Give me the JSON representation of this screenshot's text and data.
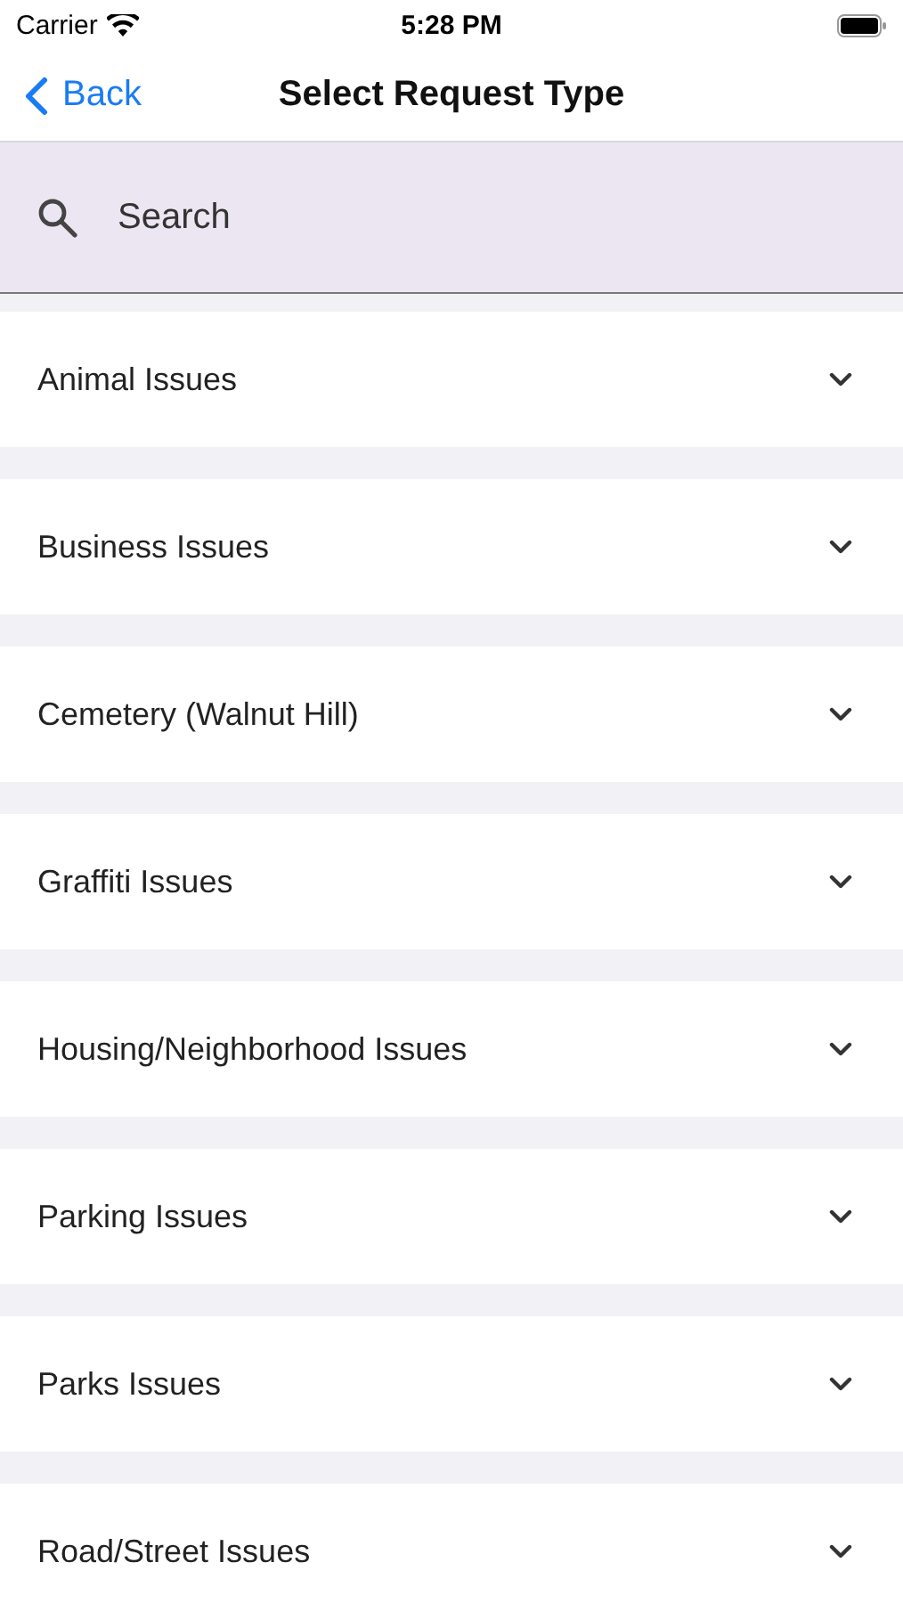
{
  "status_bar": {
    "carrier": "Carrier",
    "time": "5:28 PM"
  },
  "nav": {
    "back": "Back",
    "title": "Select Request Type"
  },
  "search": {
    "placeholder": "Search"
  },
  "categories": [
    {
      "label": "Animal Issues",
      "expanded": false
    },
    {
      "label": "Business Issues",
      "expanded": false
    },
    {
      "label": "Cemetery (Walnut Hill)",
      "expanded": false
    },
    {
      "label": "Graffiti Issues",
      "expanded": false
    },
    {
      "label": "Housing/Neighborhood Issues",
      "expanded": false
    },
    {
      "label": "Parking Issues",
      "expanded": false
    },
    {
      "label": "Parks Issues",
      "expanded": false
    },
    {
      "label": "Road/Street Issues",
      "expanded": false
    }
  ]
}
